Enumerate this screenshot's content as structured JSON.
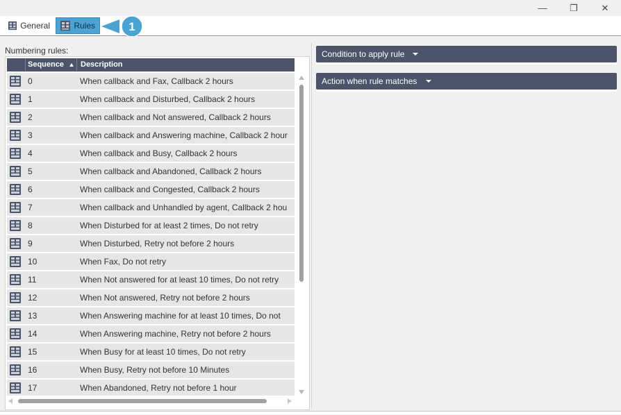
{
  "window": {
    "minimize_glyph": "—",
    "maximize_glyph": "❐",
    "close_glyph": "✕"
  },
  "tabs": [
    {
      "label": "General",
      "icon": "rules-grid-icon",
      "active": false
    },
    {
      "label": "Rules",
      "icon": "rules-grid-icon",
      "active": true
    }
  ],
  "callout": {
    "number": "1",
    "color": "#4aa3d3"
  },
  "numbering": {
    "label": "Numbering rules:",
    "columns": {
      "sequence": "Sequence",
      "description": "Description"
    },
    "rows": [
      {
        "seq": "0",
        "desc": "When callback and Fax, Callback 2 hours"
      },
      {
        "seq": "1",
        "desc": "When callback and Disturbed, Callback 2 hours"
      },
      {
        "seq": "2",
        "desc": "When callback and Not answered, Callback 2 hours"
      },
      {
        "seq": "3",
        "desc": "When callback and Answering machine, Callback 2 hour"
      },
      {
        "seq": "4",
        "desc": "When callback and Busy, Callback 2 hours"
      },
      {
        "seq": "5",
        "desc": "When callback and Abandoned, Callback 2 hours"
      },
      {
        "seq": "6",
        "desc": "When callback and Congested, Callback 2 hours"
      },
      {
        "seq": "7",
        "desc": "When callback and Unhandled by agent, Callback 2 hou"
      },
      {
        "seq": "8",
        "desc": "When Disturbed for at least 2 times, Do not retry"
      },
      {
        "seq": "9",
        "desc": "When Disturbed, Retry not before 2 hours"
      },
      {
        "seq": "10",
        "desc": "When Fax, Do not retry"
      },
      {
        "seq": "11",
        "desc": "When Not answered for at least 10 times, Do not retry"
      },
      {
        "seq": "12",
        "desc": "When Not answered, Retry not before 2 hours"
      },
      {
        "seq": "13",
        "desc": "When Answering machine for at least 10 times, Do not"
      },
      {
        "seq": "14",
        "desc": "When Answering machine, Retry not before 2 hours"
      },
      {
        "seq": "15",
        "desc": "When Busy for at least 10 times, Do not retry"
      },
      {
        "seq": "16",
        "desc": "When Busy, Retry not before 10 Minutes"
      },
      {
        "seq": "17",
        "desc": "When Abandoned, Retry not before 1 hour"
      }
    ]
  },
  "panels": {
    "condition": "Condition to apply rule",
    "action": "Action when rule matches"
  },
  "colors": {
    "header_bg": "#4b5468",
    "row_bg": "#e6e6e6",
    "active_tab": "#4aa3d3"
  }
}
